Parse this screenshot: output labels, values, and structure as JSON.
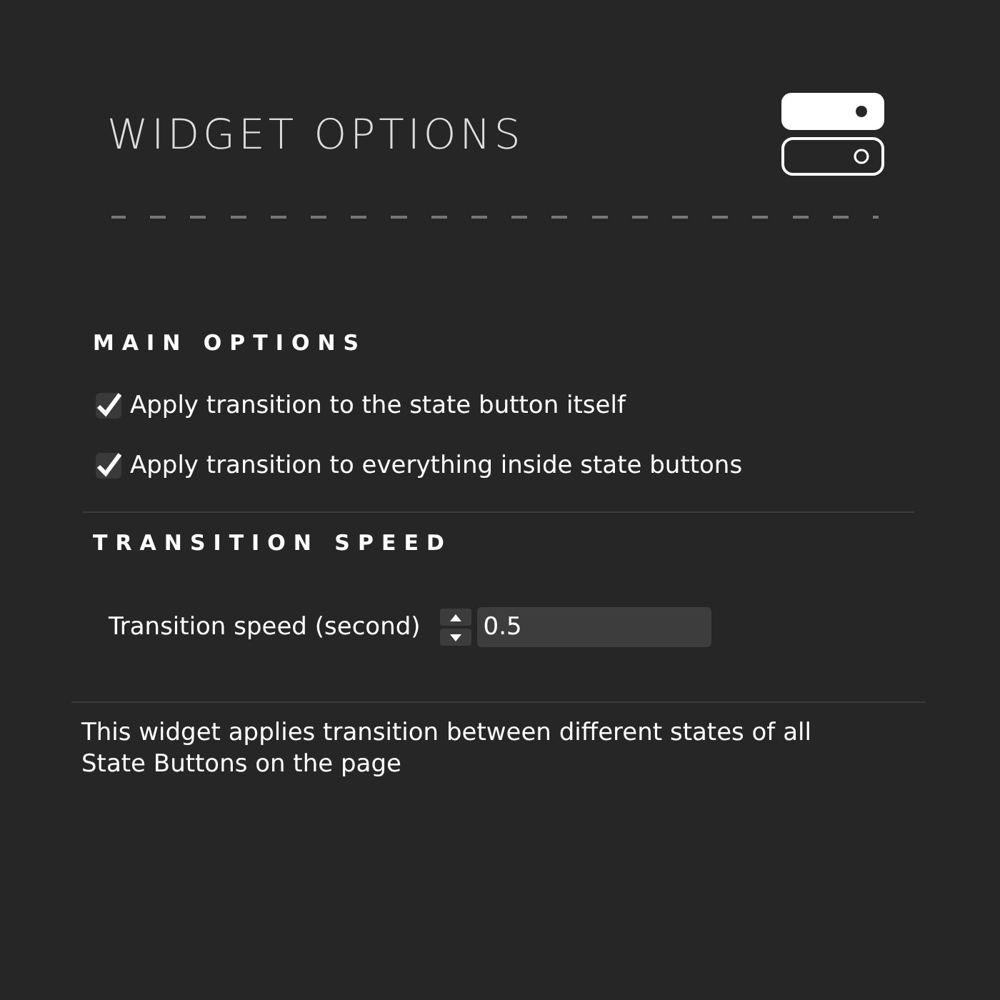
{
  "header": {
    "title": "WIDGET OPTIONS"
  },
  "sections": [
    {
      "kind": "checks",
      "heading": "MAIN OPTIONS",
      "options": [
        {
          "label": "Apply transition to the state button itself",
          "checked": true
        },
        {
          "label": "Apply transition to everything inside state buttons",
          "checked": true
        }
      ]
    },
    {
      "kind": "number",
      "heading": "TRANSITION SPEED",
      "field": {
        "label": "Transition speed (second)",
        "value": "0.5"
      }
    }
  ],
  "description": "This widget applies transition between different states of all State Buttons on the page"
}
